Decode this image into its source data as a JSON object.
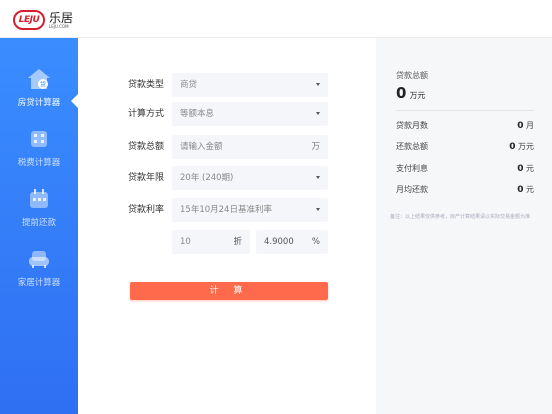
{
  "brand": {
    "badge": "LEJU",
    "cn": "乐居",
    "en": "LEJU.COM",
    "color": "#d2202f"
  },
  "sidebar": {
    "items": [
      {
        "label": "房贷计算器",
        "icon": "house-loan-icon",
        "active": true
      },
      {
        "label": "税费计算器",
        "icon": "tax-building-icon",
        "active": false
      },
      {
        "label": "提前还款",
        "icon": "calendar-icon",
        "active": false
      },
      {
        "label": "家居计算器",
        "icon": "sofa-icon",
        "active": false
      }
    ]
  },
  "form": {
    "loan_type": {
      "label": "贷款类型",
      "value": "商贷"
    },
    "calc_method": {
      "label": "计算方式",
      "value": "等额本息"
    },
    "loan_amount": {
      "label": "贷款总额",
      "placeholder": "请输入金额",
      "unit": "万"
    },
    "loan_years": {
      "label": "贷款年限",
      "value": "20年 (240期)"
    },
    "loan_rate": {
      "label": "贷款利率",
      "value": "15年10月24日基准利率"
    },
    "discount": {
      "value": "10",
      "unit": "折"
    },
    "rate_value": {
      "value": "4.9000",
      "unit": "%"
    },
    "submit_label": "计 算"
  },
  "result": {
    "total_label": "贷款总额",
    "total_value": "0",
    "total_unit": "万元",
    "rows": [
      {
        "label": "贷款月数",
        "value": "0",
        "unit": "月"
      },
      {
        "label": "还款总额",
        "value": "0",
        "unit": "万元"
      },
      {
        "label": "支付利息",
        "value": "0",
        "unit": "元"
      },
      {
        "label": "月均还款",
        "value": "0",
        "unit": "元"
      }
    ],
    "note": "备注：以上结果仅供参考，房产计算结果请以实际交易金额为准"
  },
  "colors": {
    "accent": "#ff6a4d",
    "sidebar_top": "#3a8dff",
    "sidebar_bottom": "#2f6ff2"
  }
}
